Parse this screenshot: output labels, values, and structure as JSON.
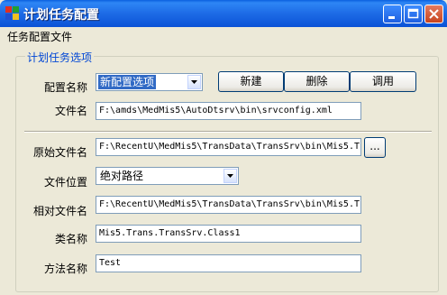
{
  "window": {
    "title": "计划任务配置"
  },
  "menu": {
    "items": [
      "任务配置文件"
    ]
  },
  "group": {
    "title": "计划任务选项"
  },
  "config": {
    "name_label": "配置名称",
    "name_value": "新配置选项",
    "file_label": "文件名",
    "file_value": "F:\\amds\\MedMis5\\AutoDtsrv\\bin\\srvconfig.xml"
  },
  "buttons": {
    "new": "新建",
    "delete": "删除",
    "invoke": "调用",
    "browse": "..."
  },
  "task": {
    "orig_file_label": "原始文件名",
    "orig_file_value": "F:\\RecentU\\MedMis5\\TransData\\TransSrv\\bin\\Mis5.Tr",
    "location_label": "文件位置",
    "location_value": "绝对路径",
    "rel_file_label": "相对文件名",
    "rel_file_value": "F:\\RecentU\\MedMis5\\TransData\\TransSrv\\bin\\Mis5.Tr",
    "class_label": "类名称",
    "class_value": "Mis5.Trans.TransSrv.Class1",
    "method_label": "方法名称",
    "method_value": "Test"
  }
}
